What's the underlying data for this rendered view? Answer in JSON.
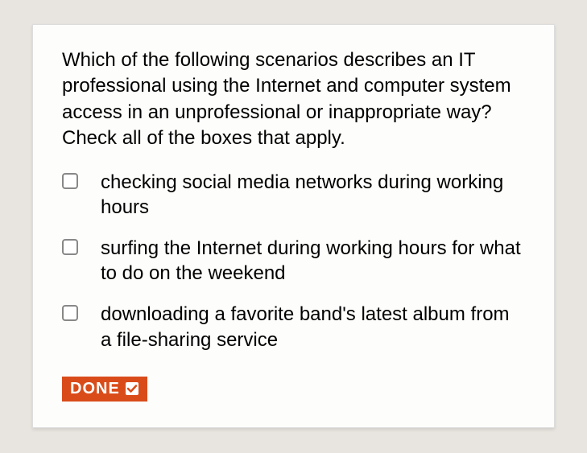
{
  "question": {
    "prompt": "Which of the following scenarios describes an IT professional using the Internet and computer system access in an unprofessional or inappropriate way? Check all of the boxes that apply.",
    "options": [
      {
        "label": "checking social media networks during working hours",
        "checked": false
      },
      {
        "label": "surfing the Internet during working hours for what to do on the weekend",
        "checked": false
      },
      {
        "label": "downloading a favorite band's latest album from a file-sharing service",
        "checked": false
      }
    ]
  },
  "done": {
    "label": "DONE"
  }
}
